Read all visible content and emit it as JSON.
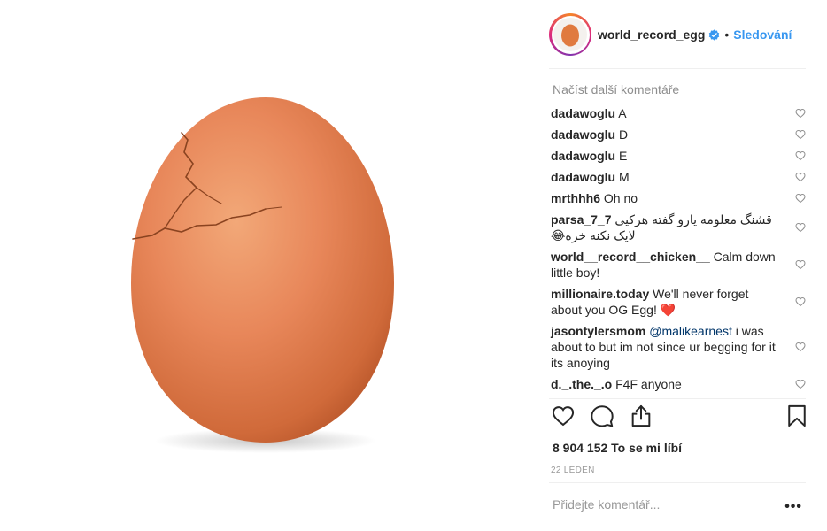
{
  "post": {
    "image_alt_icon": "egg-photo",
    "header": {
      "username": "world_record_egg",
      "verified_icon": "verified-badge-icon",
      "separator": "•",
      "follow_label": "Sledování"
    },
    "load_more_label": "Načíst další komentáře",
    "comments": [
      {
        "user": "dadawoglu",
        "text": "A"
      },
      {
        "user": "dadawoglu",
        "text": "D"
      },
      {
        "user": "dadawoglu",
        "text": "E"
      },
      {
        "user": "dadawoglu",
        "text": "M"
      },
      {
        "user": "mrthhh6",
        "text": "Oh no"
      },
      {
        "user": "parsa_7_7",
        "text": "قشنگ معلومه یارو گفته هرکیی لایک نکنه خره😂"
      },
      {
        "user": "world__record__chicken__",
        "text": "Calm down little boy!"
      },
      {
        "user": "millionaire.today",
        "text": "We'll never forget about you OG Egg! ❤️"
      },
      {
        "user": "jasontylersmom",
        "mention": "@malikearnest",
        "text": "i was about to but im not since ur begging for it its anoying"
      },
      {
        "user": "d._.the._.o",
        "text": "F4F anyone"
      }
    ],
    "actions": {
      "like_icon": "heart-outline-icon",
      "comment_icon": "comment-bubble-icon",
      "share_icon": "share-upload-icon",
      "save_icon": "bookmark-icon"
    },
    "likes_label": "8 904 152 To se mi líbí",
    "date_label": "22 LEDEN",
    "comment_placeholder": "Přidejte komentář...",
    "more_label": "•••",
    "colors": {
      "link_blue": "#3897f0",
      "egg_orange": "#e07a3f",
      "text_dark": "#262626",
      "muted_gray": "#8e8e8e"
    }
  }
}
